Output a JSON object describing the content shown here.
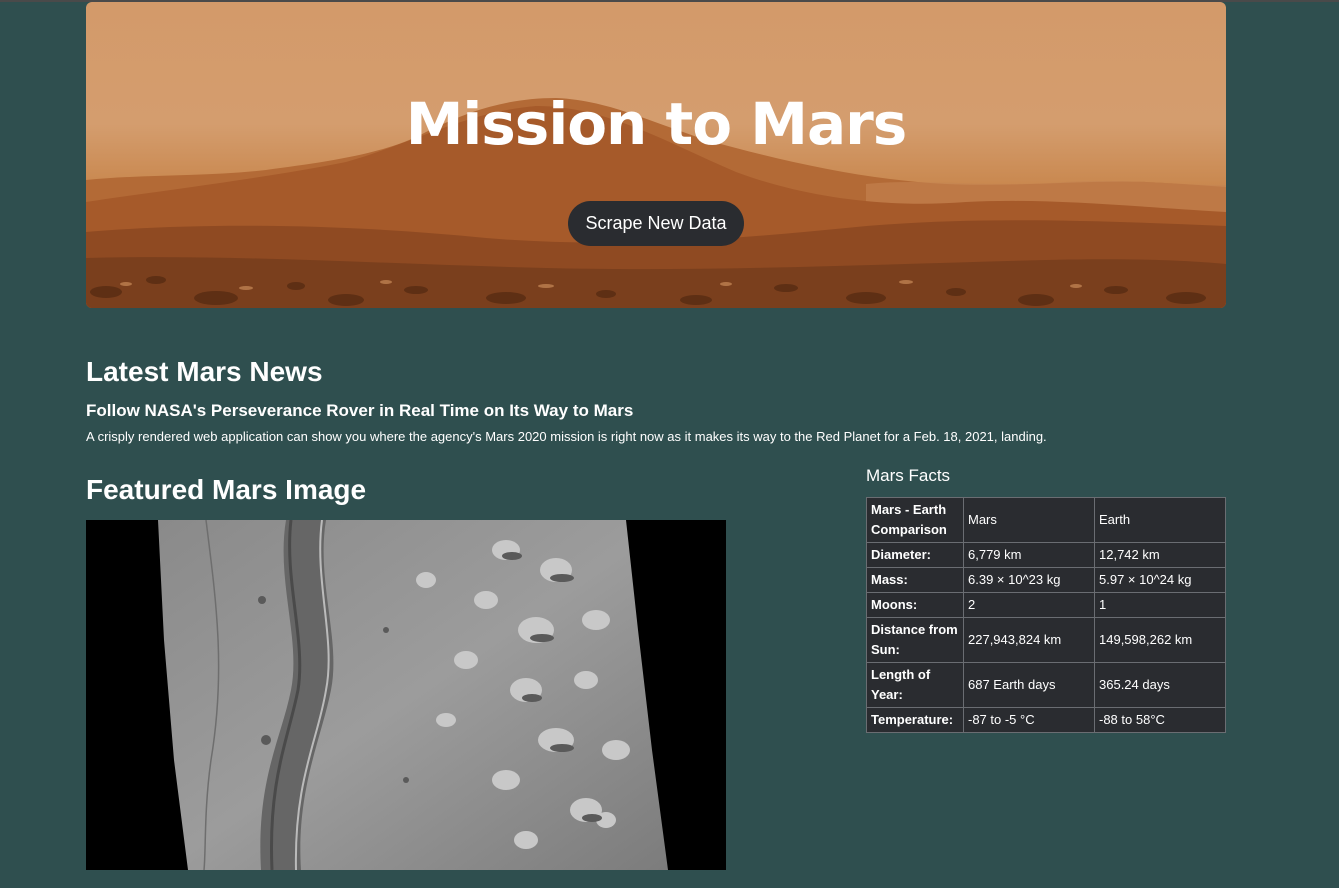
{
  "hero": {
    "title": "Mission to Mars",
    "button_label": "Scrape New Data"
  },
  "news": {
    "heading": "Latest Mars News",
    "title": "Follow NASA's Perseverance Rover in Real Time on Its Way to Mars",
    "paragraph": "A crisply rendered web application can show you where the agency's Mars 2020 mission is right now as it makes its way to the Red Planet for a Feb. 18, 2021, landing."
  },
  "featured": {
    "heading": "Featured Mars Image"
  },
  "facts": {
    "heading": "Mars Facts",
    "header_row": {
      "label": "Mars - Earth Comparison",
      "col1": "Mars",
      "col2": "Earth"
    },
    "rows": [
      {
        "label": "Diameter:",
        "mars": "6,779 km",
        "earth": "12,742 km"
      },
      {
        "label": "Mass:",
        "mars": "6.39 × 10^23 kg",
        "earth": "5.97 × 10^24 kg"
      },
      {
        "label": "Moons:",
        "mars": "2",
        "earth": "1"
      },
      {
        "label": "Distance from Sun:",
        "mars": "227,943,824 km",
        "earth": "149,598,262 km"
      },
      {
        "label": "Length of Year:",
        "mars": "687 Earth days",
        "earth": "365.24 days"
      },
      {
        "label": "Temperature:",
        "mars": "-87 to -5 °C",
        "earth": "-88 to 58°C"
      }
    ]
  },
  "colors": {
    "page_background": "#2f4f4f",
    "button_background": "#2a2c30",
    "table_background": "#2a2c30"
  }
}
